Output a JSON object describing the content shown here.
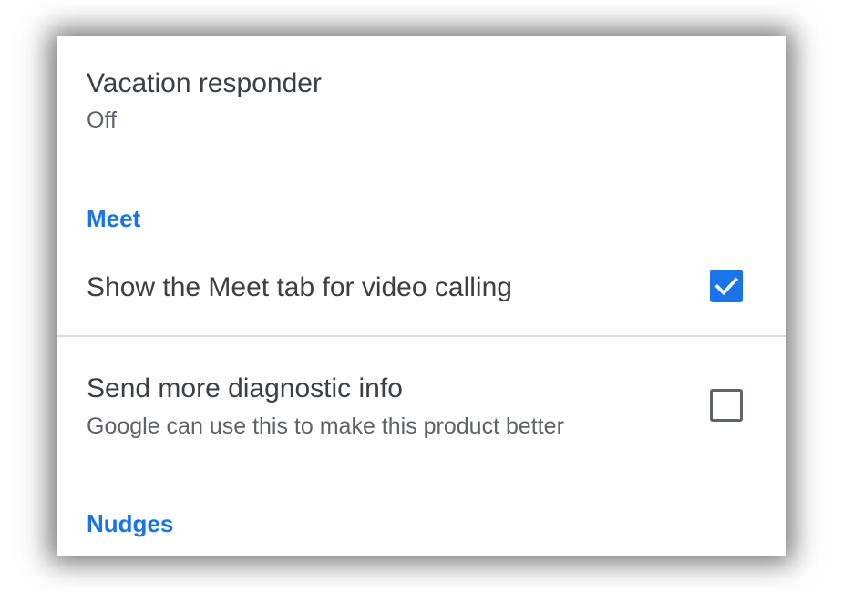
{
  "settings": {
    "vacation": {
      "title": "Vacation responder",
      "status": "Off"
    },
    "meet_section": {
      "heading": "Meet",
      "show_meet_tab": {
        "label": "Show the Meet tab for video calling",
        "checked": true
      }
    },
    "diagnostics": {
      "title": "Send more diagnostic info",
      "subtitle": "Google can use this to make this product better",
      "checked": false
    },
    "nudges_section": {
      "heading": "Nudges"
    }
  },
  "colors": {
    "accent": "#1a73e8",
    "primary_text": "#3c4043",
    "secondary_text": "#5f6368",
    "divider": "#dadce0"
  },
  "icons": {
    "checked": "check-icon"
  }
}
